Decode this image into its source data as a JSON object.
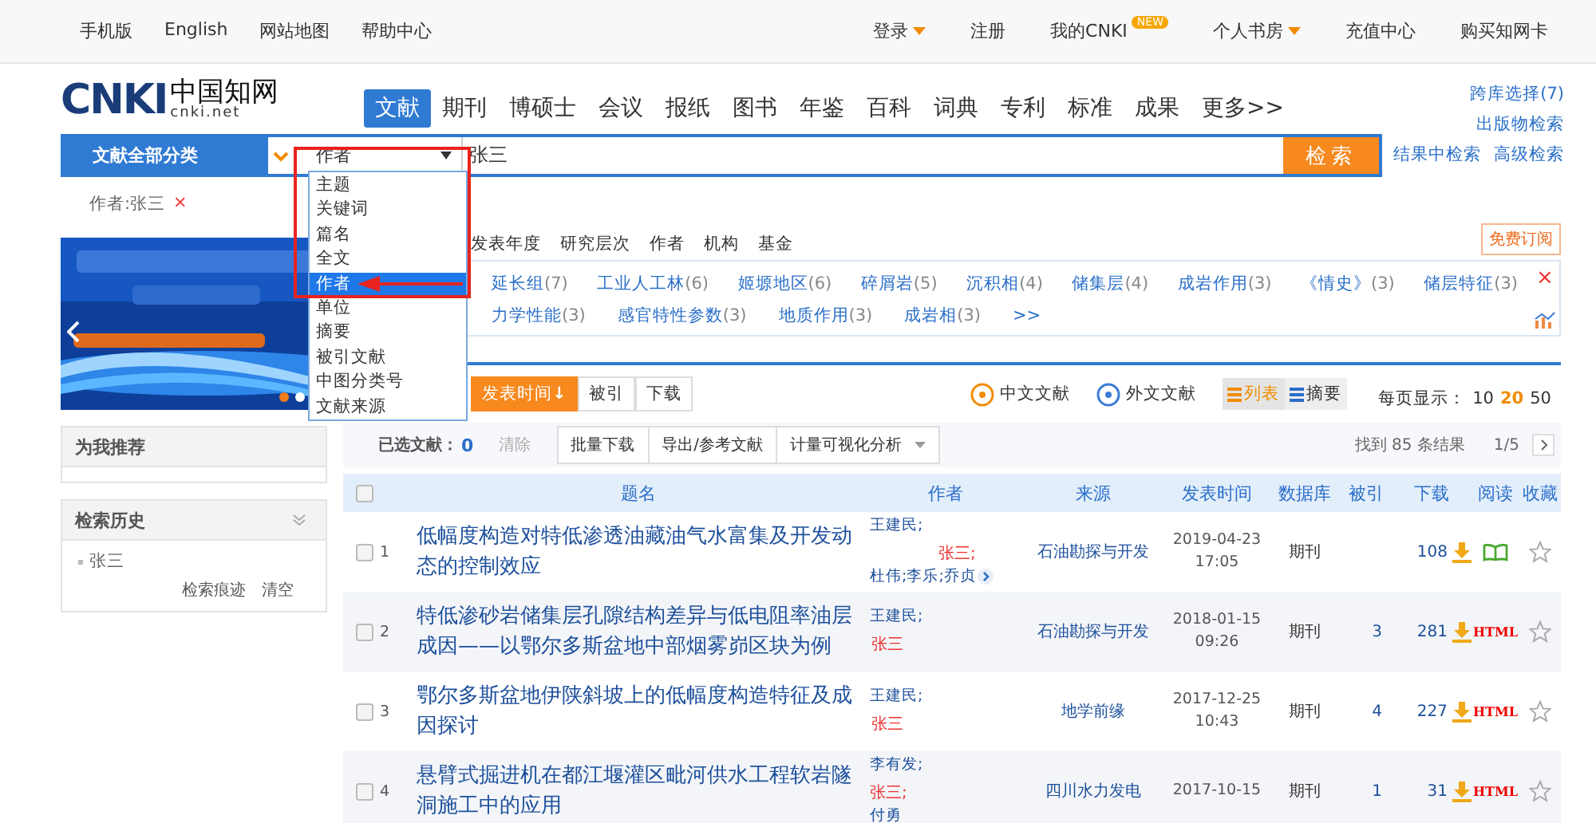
{
  "top_bar": {
    "left_links": [
      "手机版",
      "English",
      "网站地图",
      "帮助中心"
    ],
    "right_links": [
      {
        "label": "登录",
        "caret": true
      },
      {
        "label": "注册",
        "caret": false
      },
      {
        "label": "我的CNKI",
        "badge": "NEW",
        "caret": false
      },
      {
        "label": "个人书房",
        "caret": true
      },
      {
        "label": "充值中心",
        "caret": false
      },
      {
        "label": "购买知网卡",
        "caret": false
      }
    ]
  },
  "logo": {
    "letters": "CNKI",
    "chinese": "中国知网",
    "domain": "cnki.net"
  },
  "nav_tabs": [
    {
      "label": "文献",
      "selected": true
    },
    {
      "label": "期刊",
      "selected": false
    },
    {
      "label": "博硕士",
      "selected": false
    },
    {
      "label": "会议",
      "selected": false
    },
    {
      "label": "报纸",
      "selected": false
    },
    {
      "label": "图书",
      "selected": false
    },
    {
      "label": "年鉴",
      "selected": false
    },
    {
      "label": "百科",
      "selected": false
    },
    {
      "label": "词典",
      "selected": false
    },
    {
      "label": "专利",
      "selected": false
    },
    {
      "label": "标准",
      "selected": false
    },
    {
      "label": "成果",
      "selected": false
    },
    {
      "label": "更多>>",
      "selected": false
    }
  ],
  "right_links": [
    "跨库选择(7)",
    "出版物检索",
    "结果中检索",
    "高级检索"
  ],
  "search": {
    "category": "文献全部分类",
    "field": "作者",
    "value": "张三",
    "button": "检索"
  },
  "field_dropdown": {
    "options": [
      {
        "label": "主题",
        "selected": false
      },
      {
        "label": "关键词",
        "selected": false
      },
      {
        "label": "篇名",
        "selected": false
      },
      {
        "label": "全文",
        "selected": false
      },
      {
        "label": "作者",
        "selected": true
      },
      {
        "label": "单位",
        "selected": false
      },
      {
        "label": "摘要",
        "selected": false
      },
      {
        "label": "被引文献",
        "selected": false
      },
      {
        "label": "中图分类号",
        "selected": false
      },
      {
        "label": "文献来源",
        "selected": false
      }
    ]
  },
  "search_tag": {
    "label": "作者:张三",
    "remove": "×"
  },
  "banner": {
    "kind": "picture"
  },
  "sidebar": {
    "recommend_title": "为我推荐",
    "history_title": "检索历史",
    "history_items": [
      "张三"
    ],
    "history_links": [
      "检索痕迹",
      "清空"
    ]
  },
  "filter_tabs": [
    "发表年度",
    "研究层次",
    "作者",
    "机构",
    "基金"
  ],
  "subscribe": "免费订阅",
  "keyword_rows": [
    [
      {
        "name": "延长组",
        "count": "(7)"
      },
      {
        "name": "工业人工林",
        "count": "(6)"
      },
      {
        "name": "姬塬地区",
        "count": "(6)"
      },
      {
        "name": "碎屑岩",
        "count": "(5)"
      },
      {
        "name": "沉积相",
        "count": "(4)"
      },
      {
        "name": "储集层",
        "count": "(4)"
      },
      {
        "name": "成岩作用",
        "count": "(3)"
      },
      {
        "name": "《情史》",
        "count": "(3)"
      },
      {
        "name": "储层特征",
        "count": "(3)"
      }
    ],
    [
      {
        "name": "力学性能",
        "count": "(3)"
      },
      {
        "name": "感官特性参数",
        "count": "(3)"
      },
      {
        "name": "地质作用",
        "count": "(3)"
      },
      {
        "name": "成岩相",
        "count": "(3)"
      }
    ]
  ],
  "keyword_more": ">>",
  "keyword_close": "×",
  "sort_buttons": [
    {
      "label": "发表时间",
      "arrow": "↓",
      "selected": true
    },
    {
      "label": "被引",
      "selected": false
    },
    {
      "label": "下载",
      "selected": false
    }
  ],
  "language_links": [
    "中文文献",
    "外文文献"
  ],
  "view_modes": [
    {
      "label": "列表",
      "selected": true
    },
    {
      "label": "摘要",
      "selected": false
    }
  ],
  "page_size": {
    "label": "每页显示：",
    "options": [
      {
        "label": "10",
        "selected": false
      },
      {
        "label": "20",
        "selected": true
      },
      {
        "label": "50",
        "selected": false
      }
    ]
  },
  "actions": {
    "selected_label": "已选文献：",
    "selected_count": "0",
    "clear": "清除",
    "buttons": [
      "批量下载",
      "导出/参考文献",
      "计量可视化分析"
    ],
    "result_count": "找到 85 条结果",
    "page": "1/5"
  },
  "table": {
    "all_checked": false,
    "columns": [
      "题名",
      "作者",
      "来源",
      "发表时间",
      "数据库",
      "被引",
      "下载",
      "阅读",
      "收藏"
    ],
    "rows": [
      {
        "checked": false,
        "index": "1",
        "title": "低幅度构造对特低渗透油藏油气水富集及开发动态的控制效应",
        "authors": [
          {
            "name": "王建民;",
            "highlight": false
          },
          {
            "name": "张三;",
            "highlight": true
          },
          {
            "name": "杜伟;",
            "highlight": false
          },
          {
            "name": "李乐;",
            "highlight": false
          },
          {
            "name": "乔贞",
            "highlight": false
          }
        ],
        "more_authors": true,
        "source": "石油勘探与开发",
        "date": "2019-04-23",
        "time": "17:05",
        "database": "期刊",
        "downloads": "108",
        "read": {
          "kind": "book"
        }
      },
      {
        "checked": false,
        "index": "2",
        "title": "特低渗砂岩储集层孔隙结构差异与低电阻率油层成因——以鄂尔多斯盆地中部烟雾峁区块为例",
        "authors": [
          {
            "name": "王建民;",
            "highlight": false
          },
          {
            "name": "张三",
            "highlight": true
          }
        ],
        "more_authors": false,
        "source": "石油勘探与开发",
        "date": "2018-01-15",
        "time": "09:26",
        "database": "期刊",
        "cited": "3",
        "downloads": "281",
        "read": {
          "kind": "html",
          "label": "HTML"
        }
      },
      {
        "checked": false,
        "index": "3",
        "title": "鄂尔多斯盆地伊陕斜坡上的低幅度构造特征及成因探讨",
        "authors": [
          {
            "name": "王建民;",
            "highlight": false
          },
          {
            "name": "张三",
            "highlight": true
          }
        ],
        "more_authors": false,
        "source": "地学前缘",
        "date": "2017-12-25",
        "time": "10:43",
        "database": "期刊",
        "cited": "4",
        "downloads": "227",
        "read": {
          "kind": "html",
          "label": "HTML"
        }
      },
      {
        "checked": false,
        "index": "4",
        "title": "悬臂式掘进机在都江堰灌区毗河供水工程软岩隧洞施工中的应用",
        "authors": [
          {
            "name": "李有发;",
            "highlight": false
          },
          {
            "name": "张三;",
            "highlight": true
          },
          {
            "name": "付勇",
            "highlight": false
          }
        ],
        "more_authors": false,
        "source": "四川水力发电",
        "date": "2017-10-15",
        "database": "期刊",
        "cited": "1",
        "downloads": "31",
        "read": {
          "kind": "html",
          "label": "HTML"
        }
      }
    ]
  }
}
